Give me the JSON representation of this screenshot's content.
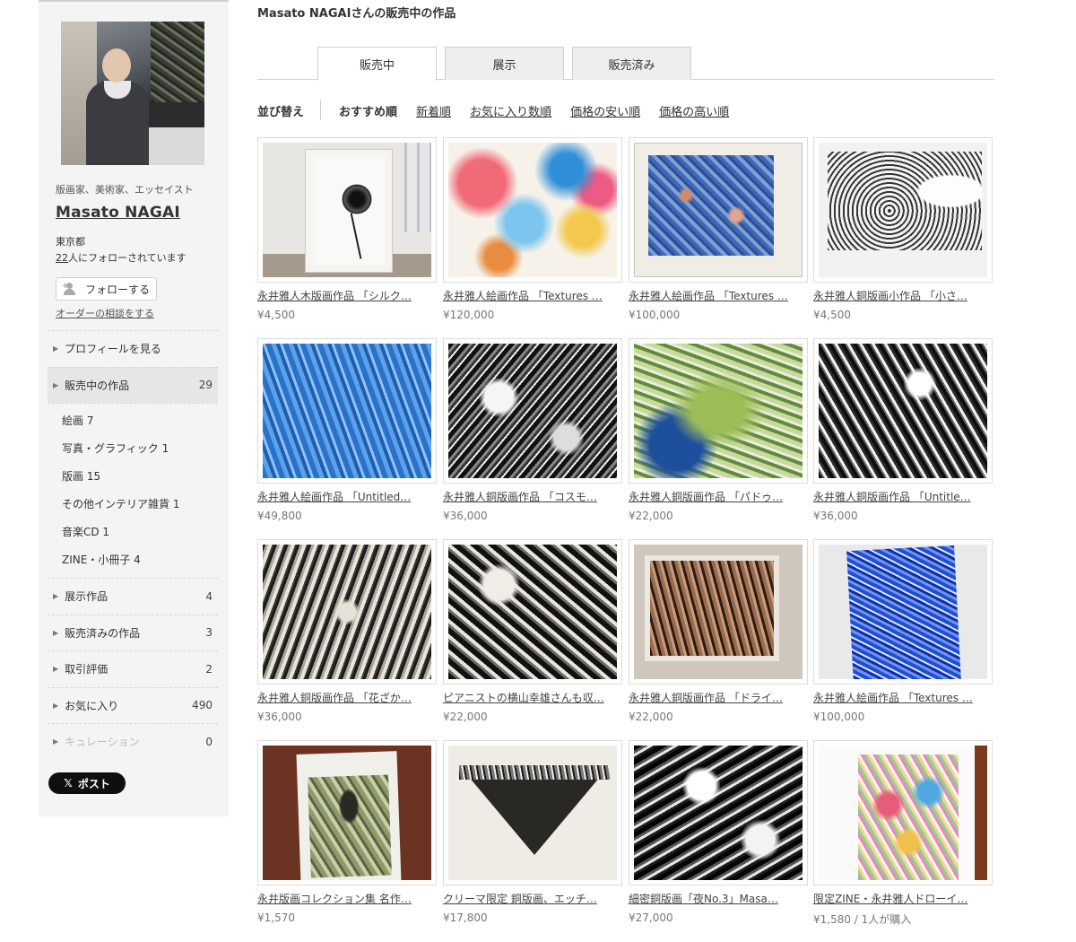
{
  "sidebar": {
    "role": "版画家、美術家、エッセイスト",
    "name": "Masato NAGAI",
    "location": "東京都",
    "followers_count": "22",
    "followers_suffix": "人にフォローされています",
    "follow_label": "フォローする",
    "order_link": "オーダーの相談をする",
    "menu": [
      {
        "label": "プロフィールを見る",
        "count": ""
      },
      {
        "label": "販売中の作品",
        "count": "29"
      }
    ],
    "submenu": [
      "絵画 7",
      "写真・グラフィック 1",
      "版画 15",
      "その他インテリア雑貨 1",
      "音楽CD 1",
      "ZINE・小冊子 4"
    ],
    "menu2": [
      {
        "label": "展示作品",
        "count": "4"
      },
      {
        "label": "販売済みの作品",
        "count": "3"
      },
      {
        "label": "取引評価",
        "count": "2"
      },
      {
        "label": "お気に入り",
        "count": "490"
      },
      {
        "label": "キュレーション",
        "count": "0"
      }
    ],
    "post_label": "ポスト",
    "post_x": "𝕏"
  },
  "main": {
    "title": "Masato NAGAIさんの販売中の作品",
    "tabs": [
      "販売中",
      "展示",
      "販売済み"
    ],
    "sort": {
      "label": "並び替え",
      "options": [
        "おすすめ順",
        "新着順",
        "お気に入り数順",
        "価格の安い順",
        "価格の高い順"
      ]
    },
    "items": [
      {
        "title": "永井雅人木版画作品 「シルク…",
        "price": "¥4,500"
      },
      {
        "title": "永井雅人絵画作品 「Textures …",
        "price": "¥120,000"
      },
      {
        "title": "永井雅人絵画作品 「Textures …",
        "price": "¥100,000"
      },
      {
        "title": "永井雅人銅版画小作品 「小さ…",
        "price": "¥4,500"
      },
      {
        "title": "永井雅人絵画作品 「Untitled…",
        "price": "¥49,800"
      },
      {
        "title": "永井雅人銅版画作品 「コスモ…",
        "price": "¥36,000"
      },
      {
        "title": "永井雅人銅版画作品 「パドゥ…",
        "price": "¥22,000"
      },
      {
        "title": "永井雅人銅版画作品 「Untitle…",
        "price": "¥36,000"
      },
      {
        "title": "永井雅人銅版画作品 「花ざか…",
        "price": "¥36,000"
      },
      {
        "title": "ピアニストの横山幸雄さんも収…",
        "price": "¥22,000"
      },
      {
        "title": "永井雅人銅版画作品 「ドライ…",
        "price": "¥22,000"
      },
      {
        "title": "永井雅人絵画作品 「Textures …",
        "price": "¥100,000"
      },
      {
        "title": "永井版画コレクション集 名作…",
        "price": "¥1,570"
      },
      {
        "title": "クリーマ限定 銅版画、エッチ…",
        "price": "¥17,800"
      },
      {
        "title": " 細密銅版画「夜No.3」Masa…",
        "price": "¥27,000"
      },
      {
        "title": "限定ZINE・永井雅人ドローイ…",
        "price": "¥1,580 / 1人が購入"
      }
    ]
  }
}
